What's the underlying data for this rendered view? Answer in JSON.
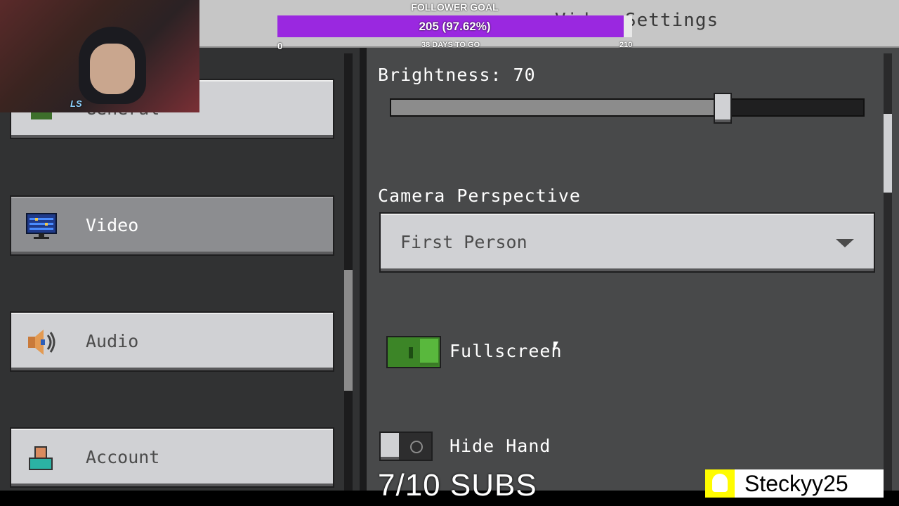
{
  "header": {
    "title": "Video Settings"
  },
  "follower_goal": {
    "label": "FOLLOWER GOAL",
    "progress_text": "205 (97.62%)",
    "progress_fraction": 0.9762,
    "min": "0",
    "max": "210",
    "days_left": "38 DAYS TO GO"
  },
  "sidebar": {
    "items": [
      {
        "label": "General",
        "icon": "general-cube-icon"
      },
      {
        "label": "Video",
        "icon": "monitor-icon",
        "active": true
      },
      {
        "label": "Audio",
        "icon": "speaker-icon"
      },
      {
        "label": "Account",
        "icon": "profile-icon"
      }
    ]
  },
  "settings": {
    "brightness": {
      "label": "Brightness: 70",
      "value": 70,
      "max": 100
    },
    "camera": {
      "label": "Camera Perspective",
      "value": "First Person"
    },
    "fullscreen": {
      "label": "Fullscreen",
      "on": true
    },
    "hide_hand": {
      "label": "Hide Hand",
      "on": false
    }
  },
  "stream_overlay": {
    "webcam_logo": "LS",
    "subs_goal": "7/10 SUBS",
    "snapchat_handle": "Steckyy25"
  },
  "colors": {
    "goal_purple": "#9a28e0",
    "toggle_green": "#3c8527",
    "snap_yellow": "#fffc00"
  }
}
